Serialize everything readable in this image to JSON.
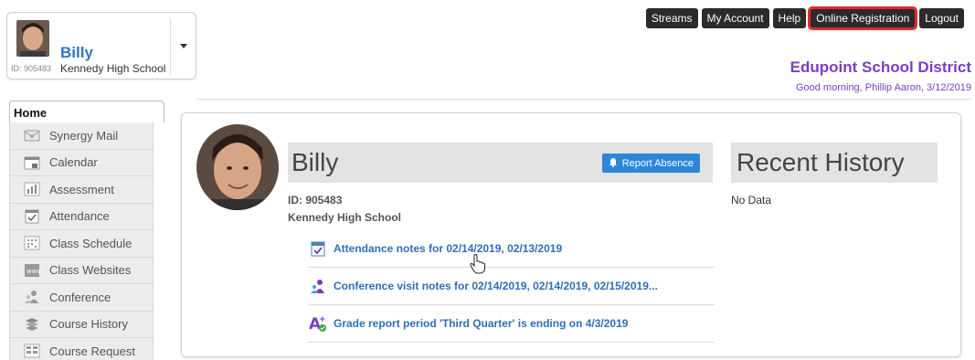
{
  "student_card": {
    "name": "Billy",
    "id": "ID: 905483",
    "school": "Kennedy High School"
  },
  "topnav": {
    "items": [
      "Streams",
      "My Account",
      "Help",
      "Online Registration",
      "Logout"
    ]
  },
  "district": "Edupoint School District",
  "greeting": "Good morning, Phillip Aaron, 3/12/2019",
  "sidebar": {
    "home": "Home",
    "items": [
      {
        "label": "Synergy Mail",
        "icon": "mail-icon"
      },
      {
        "label": "Calendar",
        "icon": "calendar-icon"
      },
      {
        "label": "Assessment",
        "icon": "chart-icon"
      },
      {
        "label": "Attendance",
        "icon": "attendance-icon"
      },
      {
        "label": "Class Schedule",
        "icon": "schedule-icon"
      },
      {
        "label": "Class Websites",
        "icon": "website-icon"
      },
      {
        "label": "Conference",
        "icon": "conference-icon"
      },
      {
        "label": "Course History",
        "icon": "history-icon"
      },
      {
        "label": "Course Request",
        "icon": "request-icon"
      }
    ]
  },
  "main": {
    "name": "Billy",
    "report_absence": "Report Absence",
    "id": "ID: 905483",
    "school": "Kennedy High School",
    "notes": [
      "Attendance notes for 02/14/2019, 02/13/2019",
      "Conference visit notes for 02/14/2019, 02/14/2019, 02/15/2019...",
      "Grade report period 'Third Quarter' is ending on 4/3/2019"
    ],
    "recent_history_title": "Recent History",
    "recent_history_empty": "No Data"
  },
  "colors": {
    "link": "#2e6fb5",
    "district": "#7b3ec5",
    "report_button": "#2e86d8",
    "highlight_outline": "#e02b2b"
  }
}
